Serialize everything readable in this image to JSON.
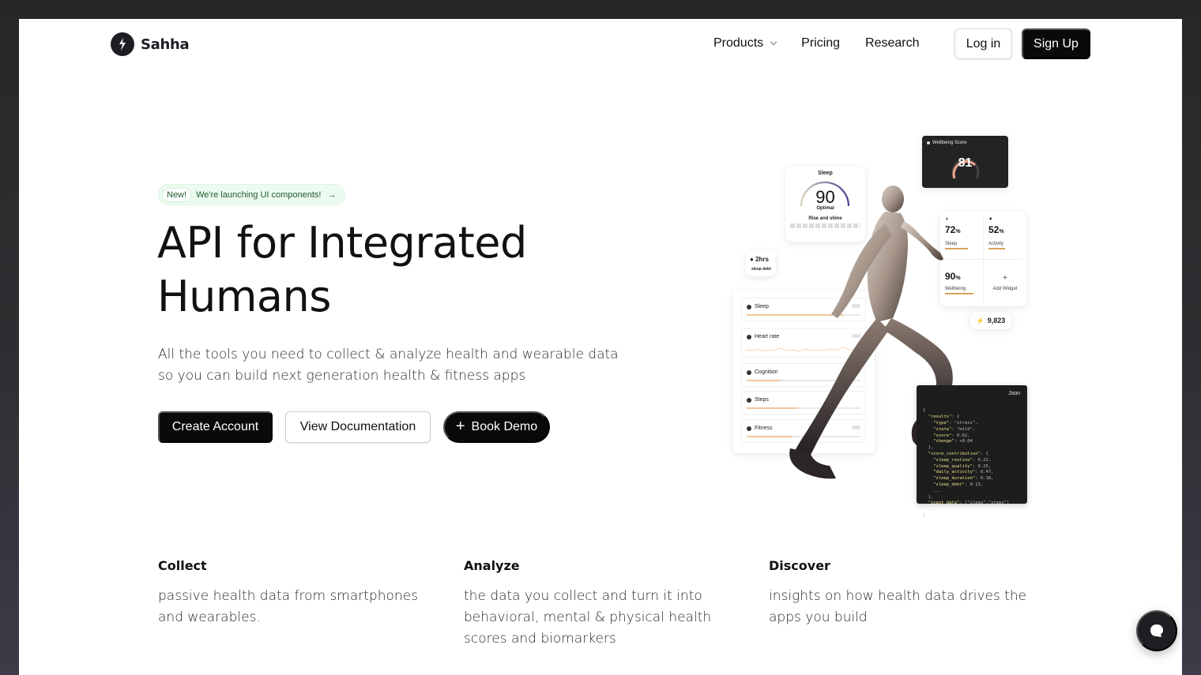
{
  "nav": {
    "brand": "Sahha",
    "links": [
      {
        "label": "Products",
        "has_dropdown": true
      },
      {
        "label": "Pricing"
      },
      {
        "label": "Research"
      }
    ],
    "login_label": "Log in",
    "signup_label": "Sign Up"
  },
  "hero": {
    "badge_tag": "New!",
    "badge_text": "We're launching UI components!",
    "badge_arrow": "→",
    "headline_line1": "API for Integrated",
    "headline_line2": "Humans",
    "subtext": "All the tools you need to collect & analyze health and wearable data so you can build next generation health & fitness apps",
    "cta_primary": "Create Account",
    "cta_secondary": "View Documentation",
    "cta_demo": "Book Demo",
    "cta_demo_icon": "+"
  },
  "illustration": {
    "wellbeing": {
      "title": "Wellbeing Score",
      "score": "81",
      "level": 0.81
    },
    "sleep": {
      "title": "Sleep",
      "score": "90",
      "status": "Optimal",
      "message": "Rise and shine",
      "level": 0.9
    },
    "sleep_debt": {
      "value": "2hrs",
      "label": "sleep debt"
    },
    "metrics": [
      {
        "label": "Sleep",
        "fill": 0.85
      },
      {
        "label": "Heart rate",
        "fill": 0
      },
      {
        "label": "Cognition",
        "fill": 0.3
      },
      {
        "label": "Steps",
        "fill": 0.45
      },
      {
        "label": "Fitness",
        "fill": 0.4
      }
    ],
    "widgets": [
      {
        "value": "72",
        "unit": "%",
        "label": "Sleep",
        "fill": 0.72
      },
      {
        "value": "52",
        "unit": "%",
        "label": "Activity",
        "fill": 0.52
      },
      {
        "value": "90",
        "unit": "%",
        "label": "Wellbeing",
        "fill": 0.9
      },
      {
        "label": "Add Widget"
      }
    ],
    "steps": "9,823",
    "json_tag": "Json",
    "json_lines": [
      "{",
      "  \"results\": {",
      "    \"type\": \"stress\",",
      "    \"state\": \"mild\",",
      "    \"score\": 0.62,",
      "    \"change\": +0.04",
      "  },",
      "  \"score_contribution\": {",
      "    \"sleep_routine\": 0.22,",
      "    \"sleep_quality\": 0.25,",
      "    \"daily_activity\": 0.47,",
      "    \"sleep_duration\": 0.18,",
      "    \"sleep_debt\": 0.13,",
      "    ...",
      "  },",
      "  \"input_data\": [\"sleep\",\"steps\"]",
      "  ...",
      "}"
    ]
  },
  "features": [
    {
      "title": "Collect",
      "text": "passive health data from smartphones and wearables."
    },
    {
      "title": "Analyze",
      "text": "the data you collect and turn it into behavioral, mental & physical health scores and biomarkers"
    },
    {
      "title": "Discover",
      "text": "insights on how health data drives the apps you build"
    }
  ],
  "colors": {
    "primary": "#0a0a0a",
    "badge_bg": "#ecfbef",
    "badge_text": "#1f5a2e",
    "accent_orange": "#f2c79a",
    "gauge_peach": "#f0a38c",
    "gauge_purple": "#4b3f8f"
  }
}
